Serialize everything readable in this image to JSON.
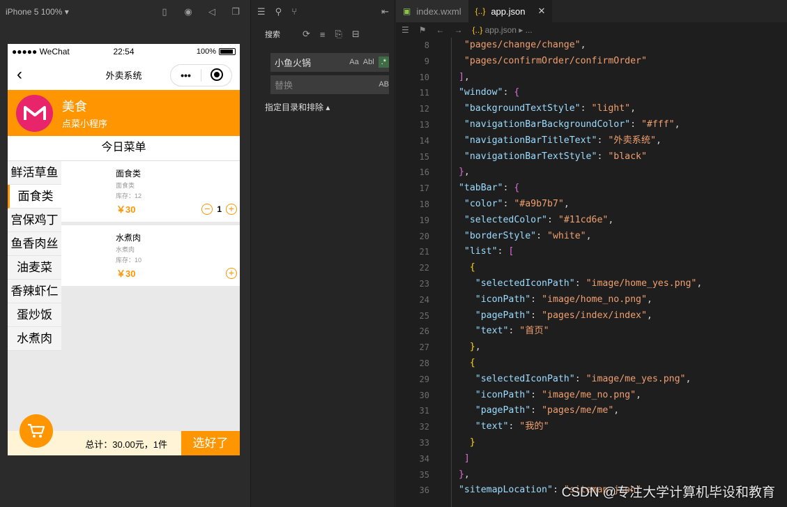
{
  "simulator": {
    "device": "iPhone 5 100% ▾",
    "status": {
      "carrier": "●●●●● WeChat",
      "time": "22:54",
      "battery": "100%"
    },
    "nav_title": "外卖系统",
    "banner": {
      "shop_name": "美食",
      "subtitle": "点菜小程序"
    },
    "menu_title": "今日菜单",
    "categories": [
      "鲜活草鱼",
      "面食类",
      "宫保鸡丁",
      "鱼香肉丝",
      "油麦菜",
      "香辣虾仁",
      "蛋炒饭",
      "水煮肉"
    ],
    "items": [
      {
        "name": "面食类",
        "category": "面食类",
        "stock": "库存：12",
        "price": "￥30",
        "qty": "1"
      },
      {
        "name": "水煮肉",
        "category": "水煮肉",
        "stock": "库存：10",
        "price": "￥30",
        "qty": ""
      }
    ],
    "footer": {
      "total": "总计：30.00元，1件",
      "checkout": "选好了"
    },
    "colors": {
      "accent": "#ff9500",
      "logo": "#e8246a"
    }
  },
  "search": {
    "title": "搜索",
    "query": "小鱼火锅",
    "replace_placeholder": "替换",
    "opt_case": "Aa",
    "opt_word": "Abl",
    "opt_regex": ".*",
    "opt_preserve": "AB",
    "scope_label": "指定目录和排除 ▴"
  },
  "editor": {
    "tabs": [
      {
        "label": "index.wxml",
        "icon": "wxml-icon"
      },
      {
        "label": "app.json",
        "icon": "json-icon",
        "close": "✕"
      }
    ],
    "breadcrumb": "app.json ▸ ...",
    "watermark": "CSDN @专注大学计算机毕设和教育"
  }
}
